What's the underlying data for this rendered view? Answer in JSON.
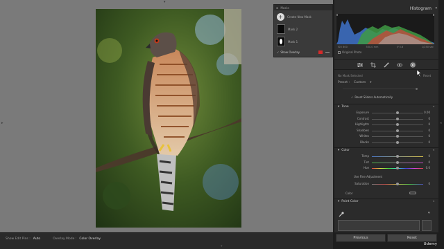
{
  "masks_panel": {
    "title": "Masks",
    "create_label": "Create New Mask",
    "masks": [
      "Mask 2",
      "Mask 1"
    ],
    "show_overlay": "Show Overlay",
    "overlay_color": "#d42a2a"
  },
  "histogram": {
    "title": "Histogram",
    "info": [
      "ISO 800",
      "500.0 mm",
      "f/ 5.6",
      "1/250 sec"
    ],
    "original_photo": "Original Photo"
  },
  "mask_panel": {
    "no_mask": "No Mask Selected",
    "reset": "Reset",
    "preset_label": "Preset :",
    "preset_value": "Custom",
    "reset_sliders": "Reset Sliders Automatically"
  },
  "tone": {
    "title": "Tone",
    "sliders": [
      {
        "label": "Exposure",
        "value": "0.00",
        "pos": 0.5
      },
      {
        "label": "Contrast",
        "value": "0",
        "pos": 0.5
      },
      {
        "label": "Highlights",
        "value": "0",
        "pos": 0.5
      },
      {
        "label": "Shadows",
        "value": "0",
        "pos": 0.5
      },
      {
        "label": "Whites",
        "value": "0",
        "pos": 0.5
      },
      {
        "label": "Blacks",
        "value": "0",
        "pos": 0.5
      }
    ]
  },
  "color": {
    "title": "Color",
    "sliders": [
      {
        "label": "Temp",
        "value": "0",
        "pos": 0.5
      },
      {
        "label": "Tint",
        "value": "0",
        "pos": 0.5
      },
      {
        "label": "Hue",
        "value": "0.0",
        "pos": 0.5
      }
    ],
    "fine_adjust": "Use Fine Adjustment",
    "saturation": {
      "label": "Saturation",
      "value": "0",
      "pos": 0.5
    },
    "color_label": "Color"
  },
  "point_color": {
    "title": "Point Color"
  },
  "bottom_bar": {
    "show_edit_pins": "Show Edit Pins :",
    "pins_value": "Auto",
    "overlay_mode": "Overlay Mode :",
    "overlay_value": "Color Overlay"
  },
  "buttons": {
    "previous": "Previous",
    "reset": "Reset"
  },
  "watermark": "Udemy"
}
